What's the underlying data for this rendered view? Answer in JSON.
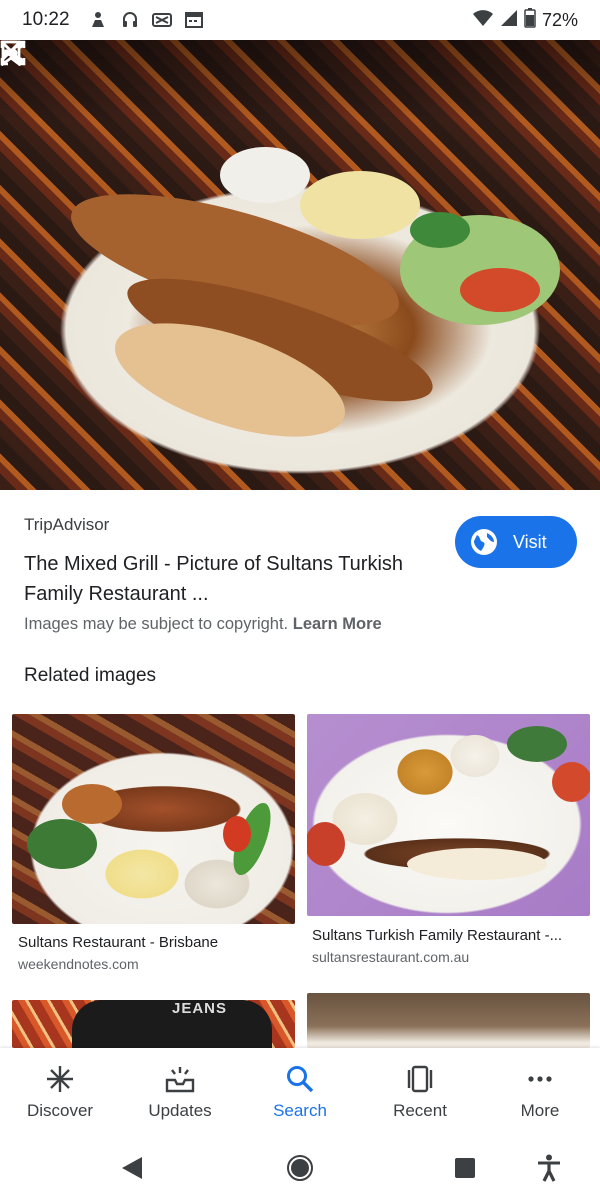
{
  "status_bar": {
    "time": "10:22",
    "battery": "72%",
    "icons_left": [
      "person-icon",
      "headset-icon",
      "cast-off-icon",
      "calendar-icon"
    ],
    "icons_right": [
      "wifi-icon",
      "signal-icon",
      "battery-icon"
    ]
  },
  "viewer": {
    "image_description_icons": [
      "close-icon",
      "lens-icon",
      "share-icon",
      "bookmark-icon"
    ]
  },
  "result": {
    "source": "TripAdvisor",
    "title": "The Mixed Grill - Picture of Sultans Turkish Family Restaurant ...",
    "visit_label": "Visit",
    "copyright_text": "Images may be subject to copyright.",
    "learn_more": "Learn More"
  },
  "related": {
    "heading": "Related images",
    "items": [
      {
        "title": "Sultans Restaurant - Brisbane",
        "site": "weekendnotes.com"
      },
      {
        "title": "Sultans Turkish Family Restaurant -...",
        "site": "sultansrestaurant.com.au"
      },
      {
        "title": "",
        "site": "",
        "overlay_text": "JEANS"
      },
      {
        "title": "",
        "site": ""
      }
    ]
  },
  "bottom_nav": {
    "items": [
      {
        "label": "Discover",
        "icon": "asterisk-icon"
      },
      {
        "label": "Updates",
        "icon": "updates-icon"
      },
      {
        "label": "Search",
        "icon": "search-icon"
      },
      {
        "label": "Recent",
        "icon": "recent-icon"
      },
      {
        "label": "More",
        "icon": "more-icon"
      }
    ],
    "active": "Search",
    "accent_color": "#1a73e8"
  },
  "system_nav": {
    "icons": [
      "back-icon",
      "home-icon",
      "overview-icon",
      "accessibility-icon"
    ]
  }
}
